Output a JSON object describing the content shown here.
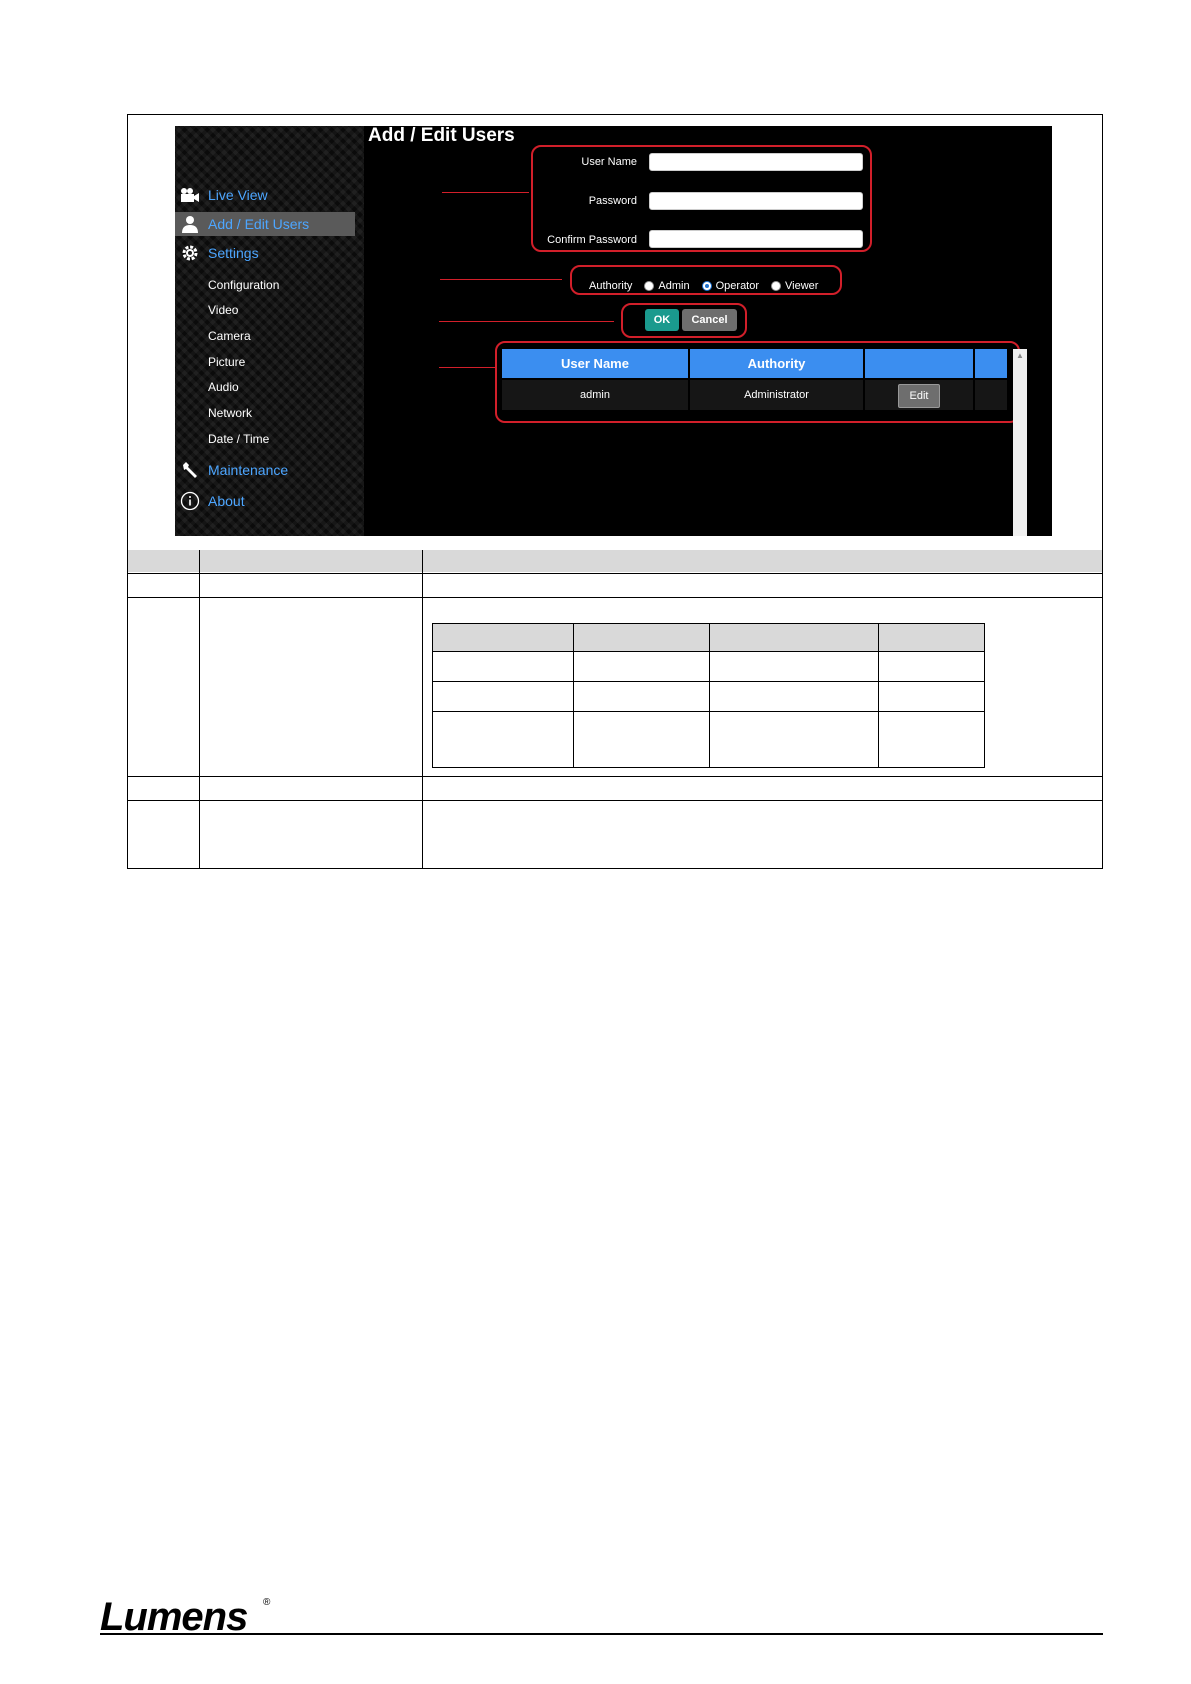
{
  "screenshot": {
    "page_title": "Add / Edit Users",
    "nav": {
      "live_view": "Live View",
      "add_edit_users": "Add / Edit Users",
      "settings": "Settings",
      "sub_items": [
        "Configuration",
        "Video",
        "Camera",
        "Picture",
        "Audio",
        "Network",
        "Date / Time"
      ],
      "maintenance": "Maintenance",
      "about": "About"
    },
    "form": {
      "user_name_label": "User Name",
      "password_label": "Password",
      "confirm_password_label": "Confirm Password",
      "user_name_value": "",
      "password_value": "",
      "confirm_password_value": ""
    },
    "authority": {
      "label": "Authority",
      "options": [
        "Admin",
        "Operator",
        "Viewer"
      ],
      "selected": "Operator"
    },
    "buttons": {
      "ok": "OK",
      "cancel": "Cancel"
    },
    "user_table": {
      "headers": [
        "User Name",
        "Authority",
        "",
        ""
      ],
      "rows": [
        {
          "user_name": "admin",
          "authority": "Administrator",
          "action": "Edit"
        }
      ]
    }
  },
  "footer": {
    "logo": "Lumens",
    "registered": "®"
  },
  "colors": {
    "accent_blue": "#3b8ef0",
    "highlight_red": "#d21f2a",
    "ok_teal": "#1a9a8e"
  }
}
